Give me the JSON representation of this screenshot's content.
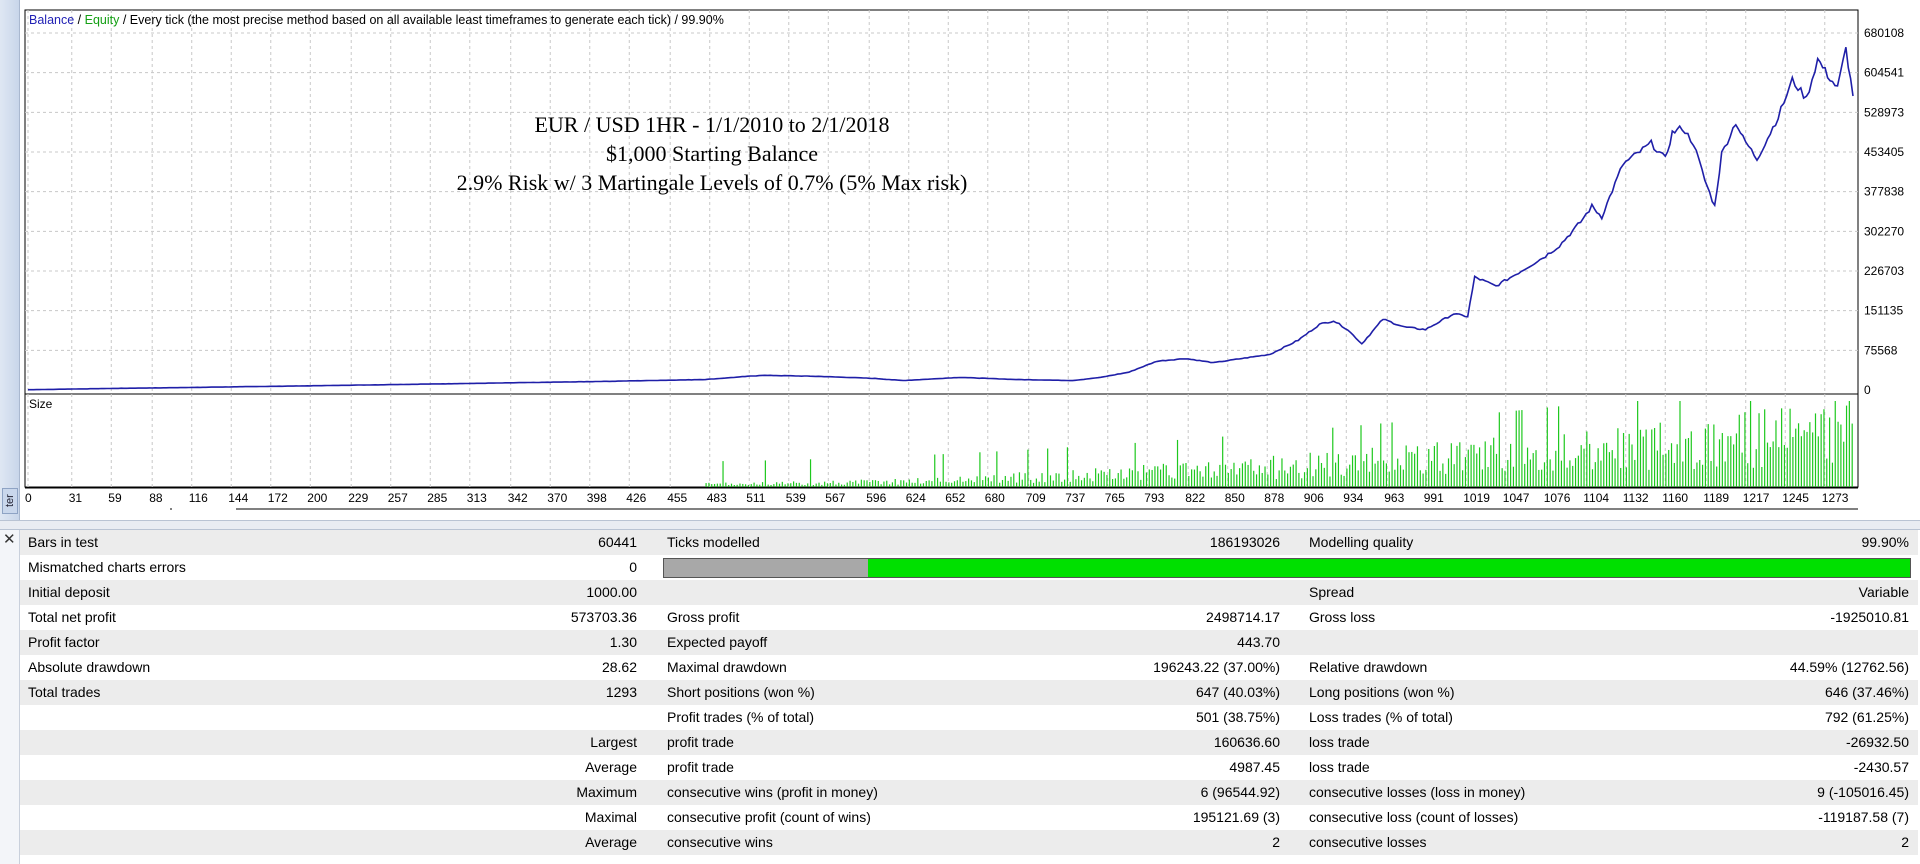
{
  "chart_header": {
    "balance": "Balance",
    "sep1": " / ",
    "equity": "Equity",
    "rest": " / Every tick (the most precise method based on all available least timeframes to generate each tick) / 99.90%"
  },
  "annotation": {
    "line1": "EUR / USD 1HR - 1/1/2010 to 2/1/2018",
    "line2": "$1,000 Starting Balance",
    "line3": "2.9% Risk w/ 3 Martingale Levels of 0.7% (5% Max risk)"
  },
  "size_label": "Size",
  "left_tab_label": "ter",
  "chart_data": {
    "type": "line",
    "y_axis_ticks": [
      "680108",
      "604541",
      "528973",
      "453405",
      "377838",
      "302270",
      "226703",
      "151135",
      "75568",
      "0"
    ],
    "ylim": [
      0,
      680108
    ],
    "x_axis_ticks": [
      "0",
      "31",
      "59",
      "88",
      "116",
      "144",
      "172",
      "200",
      "229",
      "257",
      "285",
      "313",
      "342",
      "370",
      "398",
      "426",
      "455",
      "483",
      "511",
      "539",
      "567",
      "596",
      "624",
      "652",
      "680",
      "709",
      "737",
      "765",
      "793",
      "822",
      "850",
      "878",
      "906",
      "934",
      "963",
      "991",
      "1019",
      "1047",
      "1076",
      "1104",
      "1132",
      "1160",
      "1189",
      "1217",
      "1245",
      "1273"
    ],
    "xlim": [
      0,
      1293
    ],
    "series": [
      {
        "name": "Balance",
        "color": "#1f1fa8",
        "x": [
          0,
          60,
          120,
          200,
          300,
          400,
          480,
          520,
          560,
          600,
          620,
          660,
          700,
          740,
          760,
          780,
          800,
          820,
          840,
          860,
          880,
          900,
          915,
          925,
          935,
          945,
          960,
          975,
          990,
          1010,
          1020,
          1025,
          1040,
          1060,
          1075,
          1085,
          1100,
          1108,
          1115,
          1130,
          1140,
          1150,
          1160,
          1165,
          1172,
          1180,
          1188,
          1195,
          1200,
          1210,
          1215,
          1225,
          1240,
          1250,
          1260,
          1268,
          1275,
          1282,
          1288,
          1293
        ],
        "y": [
          500,
          3000,
          5000,
          8000,
          12000,
          16000,
          20000,
          28000,
          26000,
          22000,
          18000,
          24000,
          20000,
          18000,
          24000,
          34000,
          55000,
          60000,
          52000,
          60000,
          68000,
          95000,
          125000,
          132000,
          115000,
          88000,
          135000,
          120000,
          115000,
          145000,
          140000,
          215000,
          198000,
          230000,
          255000,
          275000,
          320000,
          350000,
          330000,
          430000,
          450000,
          470000,
          440000,
          490000,
          500000,
          470000,
          400000,
          350000,
          450000,
          510000,
          480000,
          440000,
          520000,
          590000,
          555000,
          630000,
          600000,
          575000,
          650000,
          560000
        ]
      }
    ],
    "size_series": {
      "name": "Size",
      "color": "#1ec81e"
    }
  },
  "report": {
    "rows": [
      [
        "Bars in test",
        "60441",
        "Ticks modelled",
        "186193026",
        "Modelling quality",
        "99.90%"
      ],
      [
        "Mismatched charts errors",
        "0",
        "",
        "",
        "",
        ""
      ],
      [
        "Initial deposit",
        "1000.00",
        "",
        "",
        "Spread",
        "Variable"
      ],
      [
        "Total net profit",
        "573703.36",
        "Gross profit",
        "2498714.17",
        "Gross loss",
        "-1925010.81"
      ],
      [
        "Profit factor",
        "1.30",
        "Expected payoff",
        "443.70",
        "",
        ""
      ],
      [
        "Absolute drawdown",
        "28.62",
        "Maximal drawdown",
        "196243.22 (37.00%)",
        "Relative drawdown",
        "44.59% (12762.56)"
      ],
      [
        "Total trades",
        "1293",
        "Short positions (won %)",
        "647 (40.03%)",
        "Long positions (won %)",
        "646 (37.46%)"
      ],
      [
        "",
        "",
        "Profit trades (% of total)",
        "501 (38.75%)",
        "Loss trades (% of total)",
        "792 (61.25%)"
      ],
      [
        "",
        "Largest",
        "profit trade",
        "160636.60",
        "loss trade",
        "-26932.50"
      ],
      [
        "",
        "Average",
        "profit trade",
        "4987.45",
        "loss trade",
        "-2430.57"
      ],
      [
        "",
        "Maximum",
        "consecutive wins (profit in money)",
        "6 (96544.92)",
        "consecutive losses (loss in money)",
        "9 (-105016.45)"
      ],
      [
        "",
        "Maximal",
        "consecutive profit (count of wins)",
        "195121.69 (3)",
        "consecutive loss (count of losses)",
        "-119187.58 (7)"
      ],
      [
        "",
        "Average",
        "consecutive wins",
        "2",
        "consecutive losses",
        "2"
      ]
    ],
    "quality_bar": {
      "gray_fraction": 0.164,
      "gray_color": "#a8a8a8",
      "fill_color": "#00e000"
    }
  }
}
